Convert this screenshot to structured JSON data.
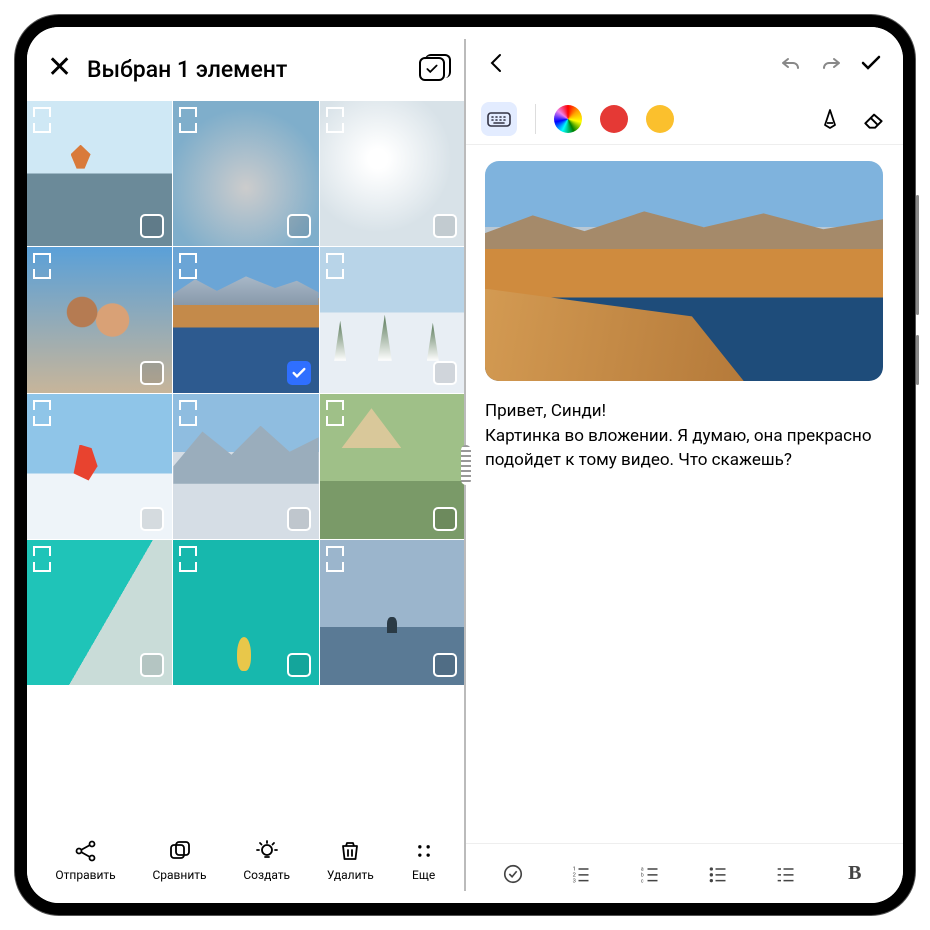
{
  "left": {
    "title": "Выбран 1 элемент",
    "thumbs": {
      "0": "cliff-jump",
      "1": "fishing-net",
      "2": "dandelion",
      "3": "family-smile",
      "4": "mountain-lake",
      "5": "winter-trees",
      "6": "skier",
      "7": "snow-peaks",
      "8": "camping",
      "9": "turquoise-shore",
      "10": "teal-kayak",
      "11": "sunset-horizon"
    },
    "selected_index": 4,
    "actions": {
      "send": "Отправить",
      "compare": "Сравнить",
      "create": "Создать",
      "delete": "Удалить",
      "more": "Еще"
    }
  },
  "right": {
    "tool_colors": {
      "red": "#e53935",
      "yellow": "#fbc02d"
    },
    "note_greeting": "Привет, Синди!",
    "note_body": "Картинка во вложении. Я думаю, она прекрасно подойдет к тому видео. Что скажешь?",
    "bold_indicator": "B"
  }
}
